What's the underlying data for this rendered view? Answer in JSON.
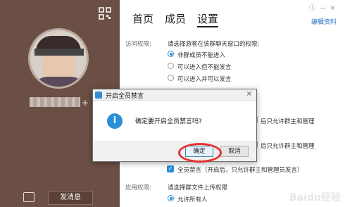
{
  "tabs": [
    "首页",
    "成员",
    "设置"
  ],
  "edit_link": "编辑资料",
  "access": {
    "label": "访问权限:",
    "prompt": "请选择游客在该群聊天窗口的权限:",
    "options": [
      "非群成员不能进入",
      "可以进入但不能发言",
      "可以进入并可以发言"
    ],
    "selected": 0
  },
  "partial_rows": [
    "后只允许群主和管理",
    "后只允许群主和管理"
  ],
  "mute_all": {
    "label": "全员禁言（开启后，只允许群主和管理员发言）",
    "checked": true
  },
  "app": {
    "label": "应用权限:",
    "prompt": "请选择群文件上传权限",
    "option": "允许所有人"
  },
  "send_button": "发消息",
  "dialog": {
    "title": "开启全员禁言",
    "close": "×",
    "message": "确定要开启全员禁言吗?",
    "ok": "确定",
    "cancel": "取消"
  },
  "watermark": "Baidu经验",
  "colors": {
    "sidebar": "#6b4f44",
    "accent": "#2a8fd8",
    "highlight_ring": "#e53232"
  }
}
